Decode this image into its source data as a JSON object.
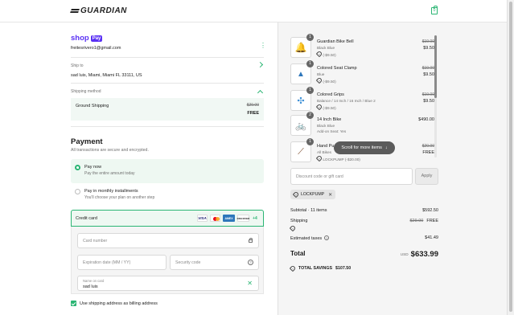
{
  "header": {
    "brand": "GUARDIAN",
    "cart_count": "0"
  },
  "contact": {
    "shop_logo": "shop",
    "shop_badge": "Pay",
    "email": "freitesrivero1@gmail.com"
  },
  "ship_to": {
    "label": "Ship to",
    "address": "sad luis, Miami, Miami FL 33111, US"
  },
  "shipping_method": {
    "label": "Shipping method",
    "name": "Ground Shipping",
    "original_price": "$29.00",
    "price": "FREE"
  },
  "payment": {
    "title": "Payment",
    "subtitle": "All transactions are secure and encrypted.",
    "options": [
      {
        "title": "Pay now",
        "subtitle": "Pay the entire amount today",
        "selected": true
      },
      {
        "title": "Pay in monthly installments",
        "subtitle": "You'll choose your plan on another step",
        "selected": false
      }
    ],
    "credit_card_label": "Credit card",
    "card_brands": [
      "VISA",
      "mastercard",
      "AMEX",
      "DISCOVER"
    ],
    "more_brands": "+4",
    "fields": {
      "card_number_placeholder": "Card number",
      "expiry_placeholder": "Expiration date (MM / YY)",
      "security_placeholder": "Security code",
      "name_label": "Name on card",
      "name_value": "sad luis"
    },
    "billing_checkbox_label": "Use shipping address as billing address",
    "billing_checked": true
  },
  "cart": {
    "items": [
      {
        "qty": "1",
        "name": "Guardian Bike Bell",
        "variant": "Black Blue",
        "discount": "(-$9.50)",
        "original_price": "$19.00",
        "price": "$9.50"
      },
      {
        "qty": "1",
        "name": "Colored Seat Clamp",
        "variant": "Blue",
        "discount": "(-$9.50)",
        "original_price": "$19.00",
        "price": "$9.50"
      },
      {
        "qty": "1",
        "name": "Colored Grips",
        "variant": "Balance / 14 Inch / 16 Inch / Blue 2",
        "discount": "(-$9.50)",
        "original_price": "$19.00",
        "price": "$9.50"
      },
      {
        "qty": "2",
        "name": "14 Inch Bike",
        "variant": "Black Blue",
        "discount": "Add-on Seat: Yes",
        "original_price": "",
        "price": "$490.00"
      },
      {
        "qty": "1",
        "name": "Hand Pu",
        "variant": "All Bikes",
        "discount": "LOCKPUMP (-$20.00)",
        "original_price": "$20.00",
        "price": "FREE"
      }
    ],
    "scroll_hint": "Scroll for more items",
    "discount_placeholder": "Discount code or gift card",
    "apply_label": "Apply",
    "applied_code": "LOCKPUMP",
    "subtotal_label": "Subtotal · 11 items",
    "subtotal_value": "$592.50",
    "shipping_label": "Shipping",
    "shipping_original": "$29.00",
    "shipping_value": "FREE",
    "taxes_label": "Estimated taxes",
    "taxes_value": "$41.49",
    "total_label": "Total",
    "total_currency": "USD",
    "total_value": "$633.99",
    "savings_label": "TOTAL SAVINGS",
    "savings_value": "$107.50"
  },
  "colors": {
    "accent": "#2ab573",
    "shop_purple": "#5a31f4",
    "summary_bg": "#f5f5f5"
  }
}
